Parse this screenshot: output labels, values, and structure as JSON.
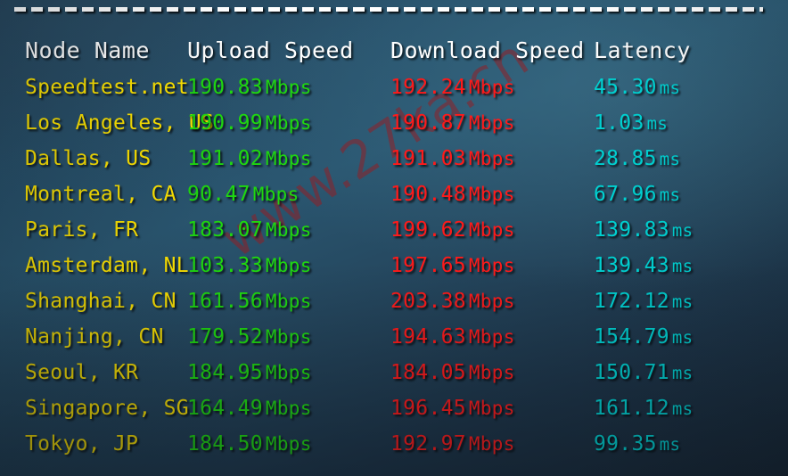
{
  "watermark": {
    "text": "www.27ka.cn",
    "color": "#961c22"
  },
  "divider": {
    "style": "dashed-line"
  },
  "table": {
    "headers": {
      "node": "Node Name",
      "upload": "Upload Speed",
      "download": "Download Speed",
      "latency": "Latency"
    },
    "units": {
      "speed": "Mbps",
      "latency": "ms"
    },
    "colors": {
      "header": "#ffffff",
      "node": "#ffe400",
      "upload": "#1fd80f",
      "download": "#ff1a1a",
      "latency": "#00d4d4",
      "background_top": "#2a5670",
      "background_bottom": "#172533"
    },
    "rows": [
      {
        "node": "Speedtest.net",
        "upload": "190.83",
        "download": "192.24",
        "latency": "45.30"
      },
      {
        "node": "Los Angeles, US",
        "upload": "190.99",
        "download": "190.87",
        "latency": "1.03"
      },
      {
        "node": "Dallas, US",
        "upload": "191.02",
        "download": "191.03",
        "latency": "28.85"
      },
      {
        "node": "Montreal, CA",
        "upload": "90.47",
        "download": "190.48",
        "latency": "67.96"
      },
      {
        "node": "Paris, FR",
        "upload": "183.07",
        "download": "199.62",
        "latency": "139.83"
      },
      {
        "node": "Amsterdam, NL",
        "upload": "103.33",
        "download": "197.65",
        "latency": "139.43"
      },
      {
        "node": "Shanghai, CN",
        "upload": "161.56",
        "download": "203.38",
        "latency": "172.12"
      },
      {
        "node": "Nanjing, CN",
        "upload": "179.52",
        "download": "194.63",
        "latency": "154.79"
      },
      {
        "node": "Seoul, KR",
        "upload": "184.95",
        "download": "184.05",
        "latency": "150.71"
      },
      {
        "node": "Singapore, SG",
        "upload": "164.49",
        "download": "196.45",
        "latency": "161.12"
      },
      {
        "node": "Tokyo, JP",
        "upload": "184.50",
        "download": "192.97",
        "latency": "99.35"
      }
    ]
  }
}
